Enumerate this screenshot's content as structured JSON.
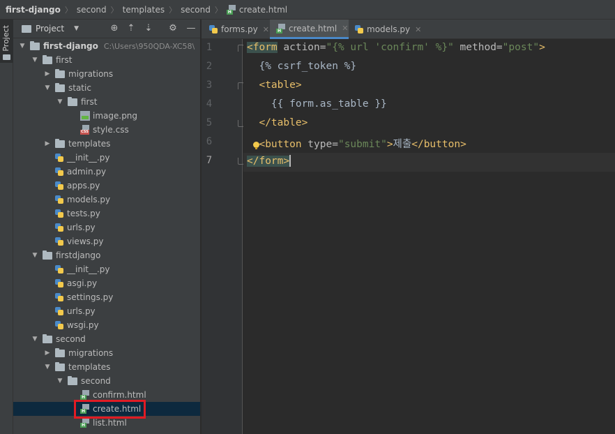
{
  "breadcrumb": [
    "first-django",
    "second",
    "templates",
    "second",
    "create.html"
  ],
  "side_strip": {
    "label": "Project"
  },
  "project_panel": {
    "title": "Project",
    "tree": [
      {
        "label": "first-django",
        "type": "folder",
        "level": 0,
        "expanded": true,
        "hint": "C:\\Users\\950QDA-XC58\\"
      },
      {
        "label": "first",
        "type": "folder",
        "level": 1,
        "expanded": true
      },
      {
        "label": "migrations",
        "type": "folder",
        "level": 2,
        "expanded": false
      },
      {
        "label": "static",
        "type": "folder",
        "level": 2,
        "expanded": true
      },
      {
        "label": "first",
        "type": "folder",
        "level": 3,
        "expanded": true
      },
      {
        "label": "image.png",
        "type": "image",
        "level": 4
      },
      {
        "label": "style.css",
        "type": "css",
        "level": 4
      },
      {
        "label": "templates",
        "type": "folder",
        "level": 2,
        "expanded": false
      },
      {
        "label": "__init__.py",
        "type": "python",
        "level": 2
      },
      {
        "label": "admin.py",
        "type": "python",
        "level": 2
      },
      {
        "label": "apps.py",
        "type": "python",
        "level": 2
      },
      {
        "label": "models.py",
        "type": "python",
        "level": 2
      },
      {
        "label": "tests.py",
        "type": "python",
        "level": 2
      },
      {
        "label": "urls.py",
        "type": "python",
        "level": 2
      },
      {
        "label": "views.py",
        "type": "python",
        "level": 2
      },
      {
        "label": "firstdjango",
        "type": "folder",
        "level": 1,
        "expanded": true
      },
      {
        "label": "__init__.py",
        "type": "python",
        "level": 2
      },
      {
        "label": "asgi.py",
        "type": "python",
        "level": 2
      },
      {
        "label": "settings.py",
        "type": "python",
        "level": 2
      },
      {
        "label": "urls.py",
        "type": "python",
        "level": 2
      },
      {
        "label": "wsgi.py",
        "type": "python",
        "level": 2
      },
      {
        "label": "second",
        "type": "folder",
        "level": 1,
        "expanded": true
      },
      {
        "label": "migrations",
        "type": "folder",
        "level": 2,
        "expanded": false
      },
      {
        "label": "templates",
        "type": "folder",
        "level": 2,
        "expanded": true
      },
      {
        "label": "second",
        "type": "folder",
        "level": 3,
        "expanded": true
      },
      {
        "label": "confirm.html",
        "type": "html",
        "level": 4
      },
      {
        "label": "create.html",
        "type": "html",
        "level": 4,
        "selected": true
      },
      {
        "label": "list.html",
        "type": "html",
        "level": 4
      }
    ]
  },
  "tabs": [
    {
      "label": "forms.py",
      "type": "python",
      "active": false
    },
    {
      "label": "create.html",
      "type": "html",
      "active": true
    },
    {
      "label": "models.py",
      "type": "python",
      "active": false
    }
  ],
  "editor": {
    "line_numbers": [
      "1",
      "2",
      "3",
      "4",
      "5",
      "6",
      "7"
    ],
    "current_line": 7,
    "lines": [
      [
        {
          "t": "<form",
          "c": "tag",
          "m": true
        },
        {
          "t": " action=",
          "c": "attr"
        },
        {
          "t": "\"{% url 'confirm' %}\"",
          "c": "str"
        },
        {
          "t": " method=",
          "c": "attr"
        },
        {
          "t": "\"post\"",
          "c": "str"
        },
        {
          "t": ">",
          "c": "tag"
        }
      ],
      [
        {
          "t": "  {% csrf_token %}",
          "c": "txt"
        }
      ],
      [
        {
          "t": "  <table>",
          "c": "tag"
        }
      ],
      [
        {
          "t": "    {{ form.as_table }}",
          "c": "txt"
        }
      ],
      [
        {
          "t": "  </table>",
          "c": "tag"
        }
      ],
      [
        {
          "t": "  <button",
          "c": "tag"
        },
        {
          "t": " type=",
          "c": "attr"
        },
        {
          "t": "\"submit\"",
          "c": "str"
        },
        {
          "t": ">",
          "c": "tag"
        },
        {
          "t": "제출",
          "c": "txt"
        },
        {
          "t": "</button>",
          "c": "tag"
        }
      ],
      [
        {
          "t": "</form>",
          "c": "tag",
          "m": true
        }
      ]
    ]
  },
  "colors": {
    "selection_bg": "#0d293e",
    "highlight_box": "#e01b24",
    "tag": "#e8bf6a",
    "string": "#6a8759",
    "active_tab_underline": "#4a88c7"
  }
}
